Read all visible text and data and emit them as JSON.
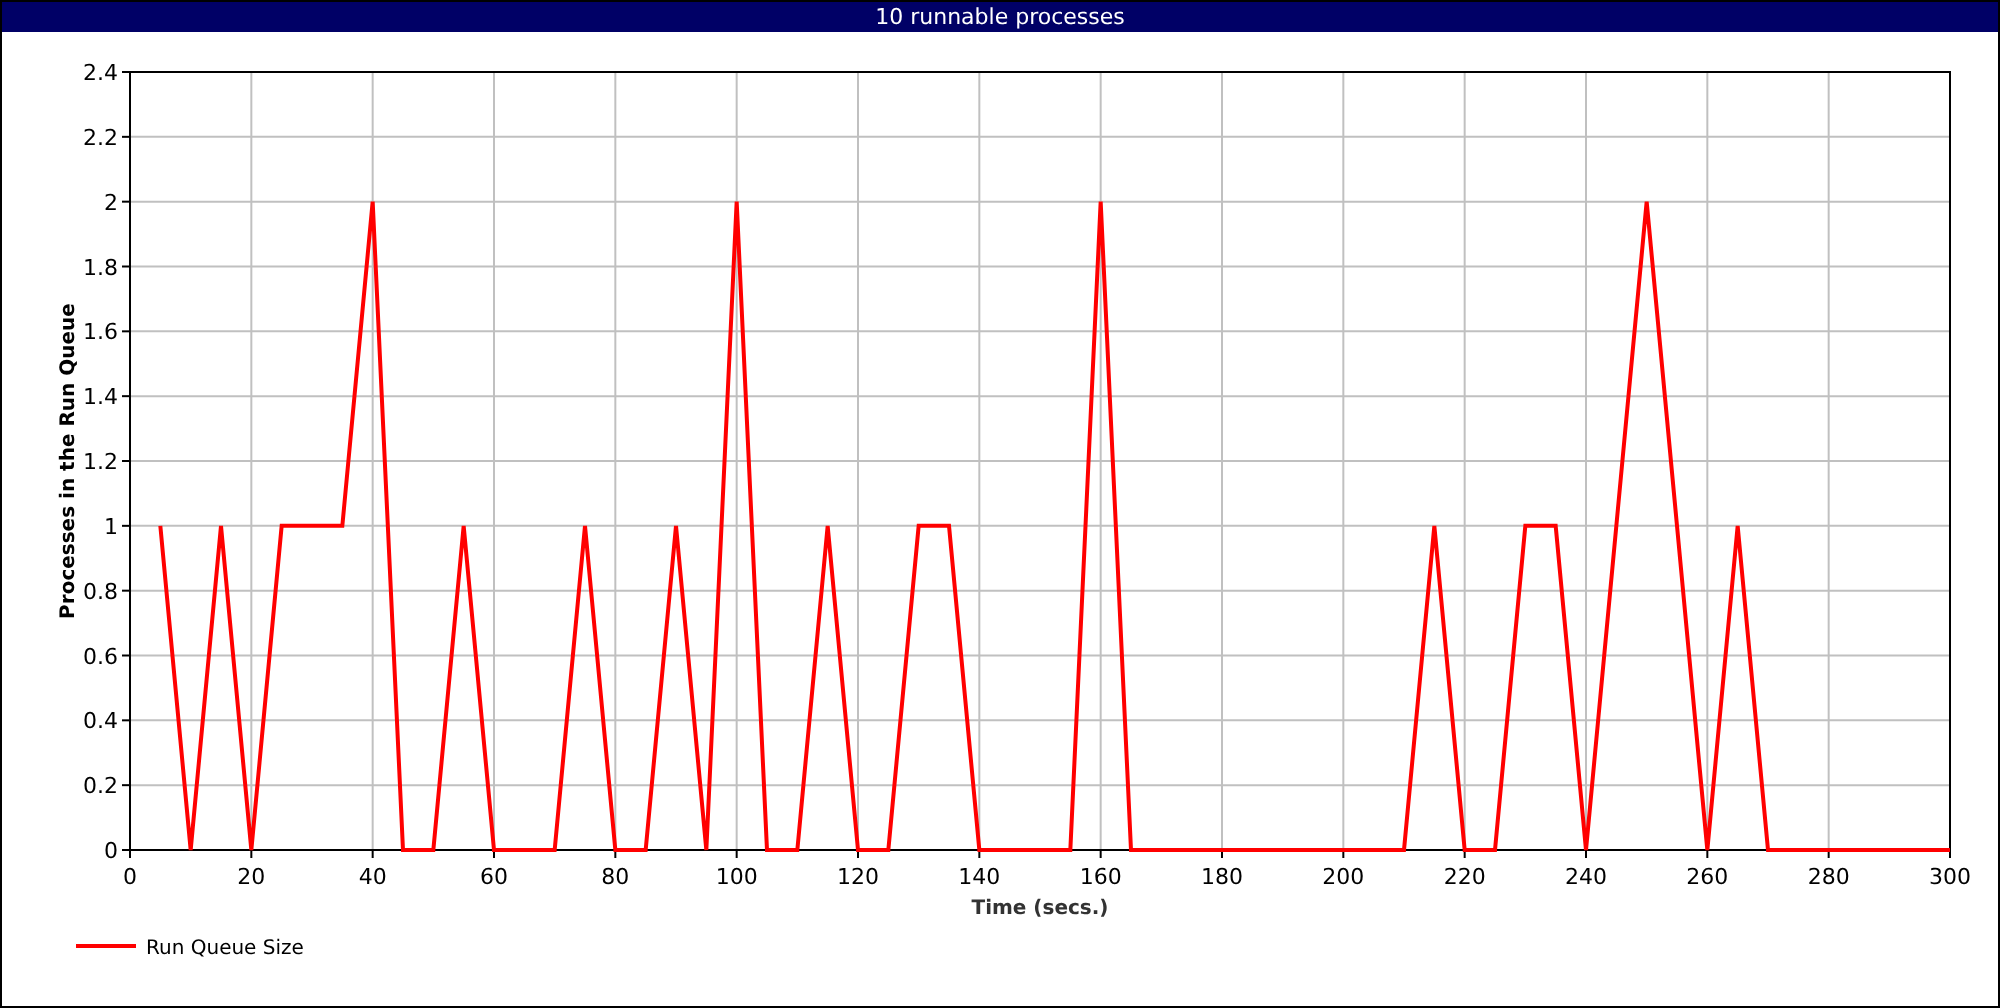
{
  "window": {
    "title": "10 runnable processes"
  },
  "chart": {
    "chart_data": {
      "type": "line",
      "xlabel": "Time (secs.)",
      "ylabel": "Processes in the Run Queue",
      "x": [
        5,
        10,
        15,
        20,
        25,
        30,
        35,
        40,
        45,
        50,
        55,
        60,
        65,
        70,
        75,
        80,
        85,
        90,
        95,
        100,
        105,
        110,
        115,
        120,
        125,
        130,
        135,
        140,
        145,
        150,
        155,
        160,
        165,
        170,
        175,
        180,
        185,
        190,
        195,
        200,
        205,
        210,
        215,
        220,
        225,
        230,
        235,
        240,
        245,
        250,
        255,
        260,
        265,
        270,
        275,
        280,
        285,
        290,
        295,
        300
      ],
      "series": [
        {
          "name": "Run Queue Size",
          "color": "#ff0000",
          "values": [
            1,
            0,
            1,
            0,
            1,
            1,
            1,
            2,
            0,
            0,
            1,
            0,
            0,
            0,
            1,
            0,
            0,
            1,
            0,
            2,
            0,
            0,
            1,
            0,
            0,
            1,
            1,
            0,
            0,
            0,
            0,
            2,
            0,
            0,
            0,
            0,
            0,
            0,
            0,
            0,
            0,
            0,
            1,
            0,
            0,
            1,
            1,
            0,
            1,
            2,
            1,
            0,
            1,
            0,
            0,
            0,
            0,
            0,
            0,
            0
          ]
        }
      ],
      "xlim": [
        0,
        300
      ],
      "ylim": [
        0,
        2.4
      ],
      "xticks": [
        0,
        20,
        40,
        60,
        80,
        100,
        120,
        140,
        160,
        180,
        200,
        220,
        240,
        260,
        280,
        300
      ],
      "grid": true,
      "yticks": [
        0,
        0.2,
        0.4,
        0.6,
        0.8,
        1,
        1.2,
        1.4,
        1.6,
        1.8,
        2,
        2.2,
        2.4
      ]
    }
  }
}
